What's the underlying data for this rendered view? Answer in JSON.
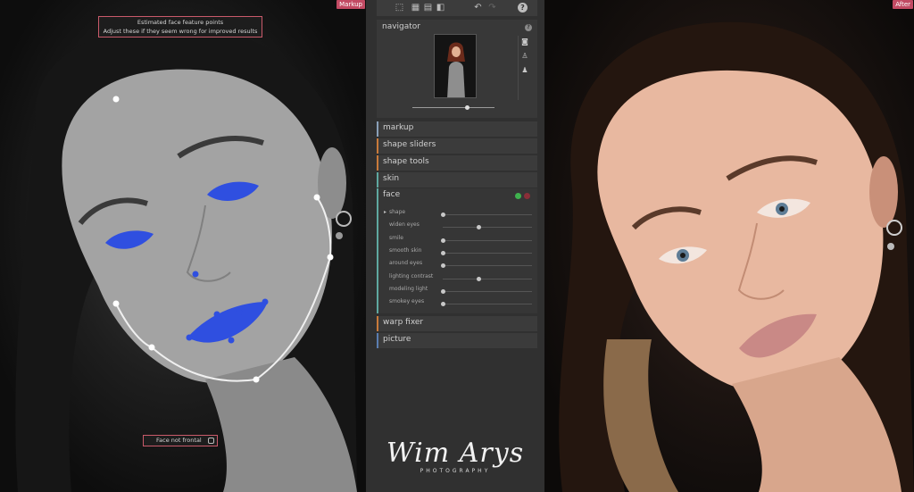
{
  "labels": {
    "markup": "Markup",
    "after": "After"
  },
  "tooltip": {
    "line1": "Estimated face feature points",
    "line2": "Adjust these if they seem wrong for improved results"
  },
  "face_not_frontal": "Face not frontal",
  "navigator": {
    "title": "navigator",
    "zoom_level": 0.66
  },
  "sections": {
    "markup": "markup",
    "shape_sliders": "shape sliders",
    "shape_tools": "shape tools",
    "skin": "skin",
    "face": "face",
    "warp_fixer": "warp fixer",
    "picture": "picture"
  },
  "face_sliders": [
    {
      "label": "shape",
      "value": 0.0,
      "expandable": true
    },
    {
      "label": "widen eyes",
      "value": 0.4
    },
    {
      "label": "smile",
      "value": 0.0
    },
    {
      "label": "smooth skin",
      "value": 0.0
    },
    {
      "label": "around eyes",
      "value": 0.0
    },
    {
      "label": "lighting contrast",
      "value": 0.4
    },
    {
      "label": "modeling light",
      "value": 0.0
    },
    {
      "label": "smokey eyes",
      "value": 0.0
    }
  ],
  "watermark": {
    "name": "Wim Arys",
    "sub": "PHOTOGRAPHY"
  },
  "colors": {
    "accent_teal": "#5fa8a0",
    "accent_orange": "#c97a3a",
    "markup_blue": "#2f4fe0",
    "status_green": "#3fb24e"
  }
}
